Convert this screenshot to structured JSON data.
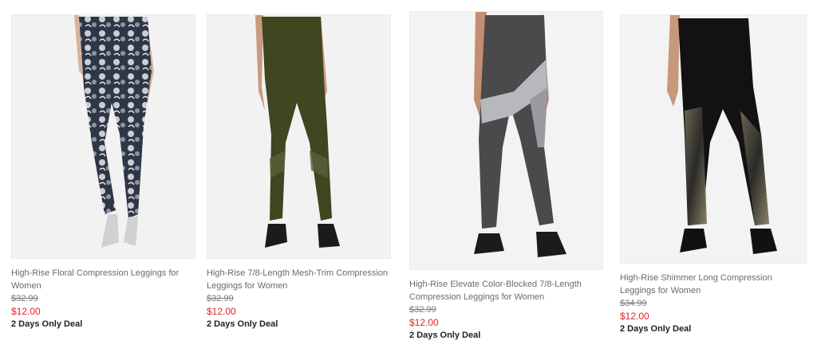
{
  "products": [
    {
      "title": "High-Rise Floral Compression Leggings for Women",
      "original_price": "$32.99",
      "sale_price": "$12.00",
      "deal": "2 Days Only Deal",
      "image": "floral-leggings-image"
    },
    {
      "title": "High-Rise 7/8-Length Mesh-Trim Compression Leggings for Women",
      "original_price": "$32.99",
      "sale_price": "$12.00",
      "deal": "2 Days Only Deal",
      "image": "olive-mesh-leggings-image"
    },
    {
      "title": "High-Rise Elevate Color-Blocked 7/8-Length Compression Leggings for Women",
      "original_price": "$32.99",
      "sale_price": "$12.00",
      "deal": "2 Days Only Deal",
      "image": "gray-colorblock-leggings-image"
    },
    {
      "title": "High-Rise Shimmer Long Compression Leggings for Women",
      "original_price": "$34.99",
      "sale_price": "$12.00",
      "deal": "2 Days Only Deal",
      "image": "black-shimmer-leggings-image"
    }
  ],
  "colors": {
    "sale_price": "#e2232a",
    "title_text": "#6b6b6b",
    "deal_text": "#222222"
  }
}
